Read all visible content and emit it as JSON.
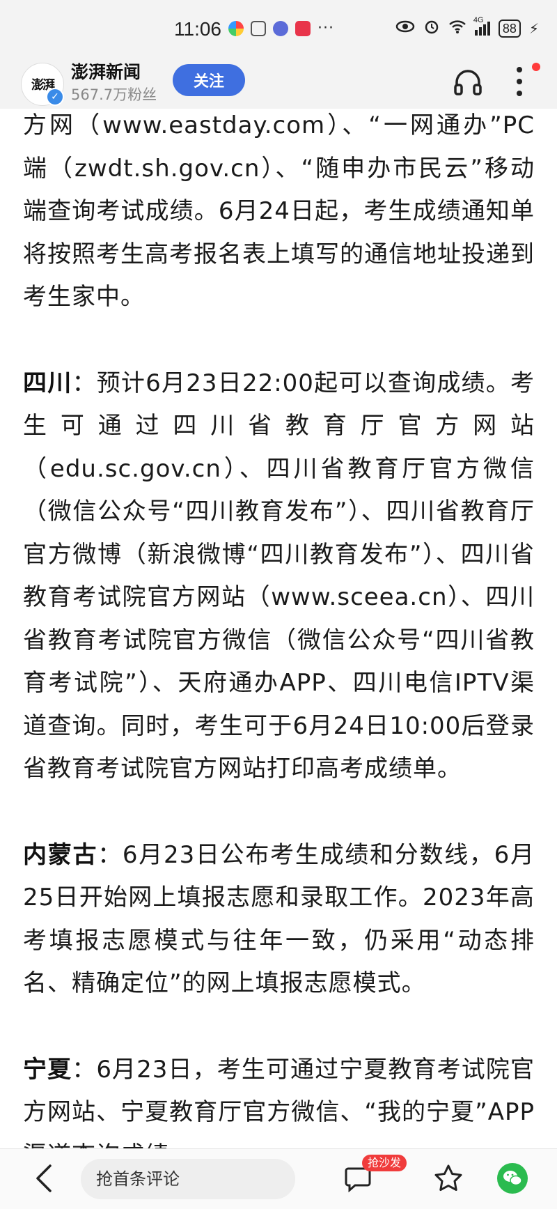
{
  "status_bar": {
    "time": "11:06",
    "network": "4G",
    "battery": "88"
  },
  "header": {
    "avatar_text": "澎湃",
    "source_name": "澎湃新闻",
    "followers": "567.7万粉丝",
    "follow_label": "关注"
  },
  "article": {
    "p1": "方网（www.eastday.com）、“一网通办”PC端（zwdt.sh.gov.cn）、“随申办市民云”移动端查询考试成绩。6月24日起，考生成绩通知单将按照考生高考报名表上填写的通信地址投递到考生家中。",
    "p2_region": "四川",
    "p2_text": "：预计6月23日22:00起可以查询成绩。考生可通过四川省教育厅官方网站（edu.sc.gov.cn）、四川省教育厅官方微信（微信公众号“四川教育发布”）、四川省教育厅官方微博（新浪微博“四川教育发布”）、四川省教育考试院官方网站（www.sceea.cn）、四川省教育考试院官方微信（微信公众号“四川省教育考试院”）、天府通办APP、四川电信IPTV渠道查询。同时，考生可于6月24日10:00后登录省教育考试院官方网站打印高考成绩单。",
    "p3_region": "内蒙古",
    "p3_text": "：6月23日公布考生成绩和分数线，6月25日开始网上填报志愿和录取工作。2023年高考填报志愿模式与往年一致，仍采用“动态排名、精确定位”的网上填报志愿模式。",
    "p4_region": "宁夏",
    "p4_text": "：6月23日，考生可通过宁夏教育考试院官方网站、宁夏教育厅官方微信、“我的宁夏”APP渠道查询成绩。"
  },
  "bottom_bar": {
    "comment_placeholder": "抢首条评论",
    "sofa_badge": "抢沙发"
  },
  "colors": {
    "accent": "#3f6fe0",
    "badge": "#f03c3c",
    "wechat": "#2bbb4f"
  }
}
